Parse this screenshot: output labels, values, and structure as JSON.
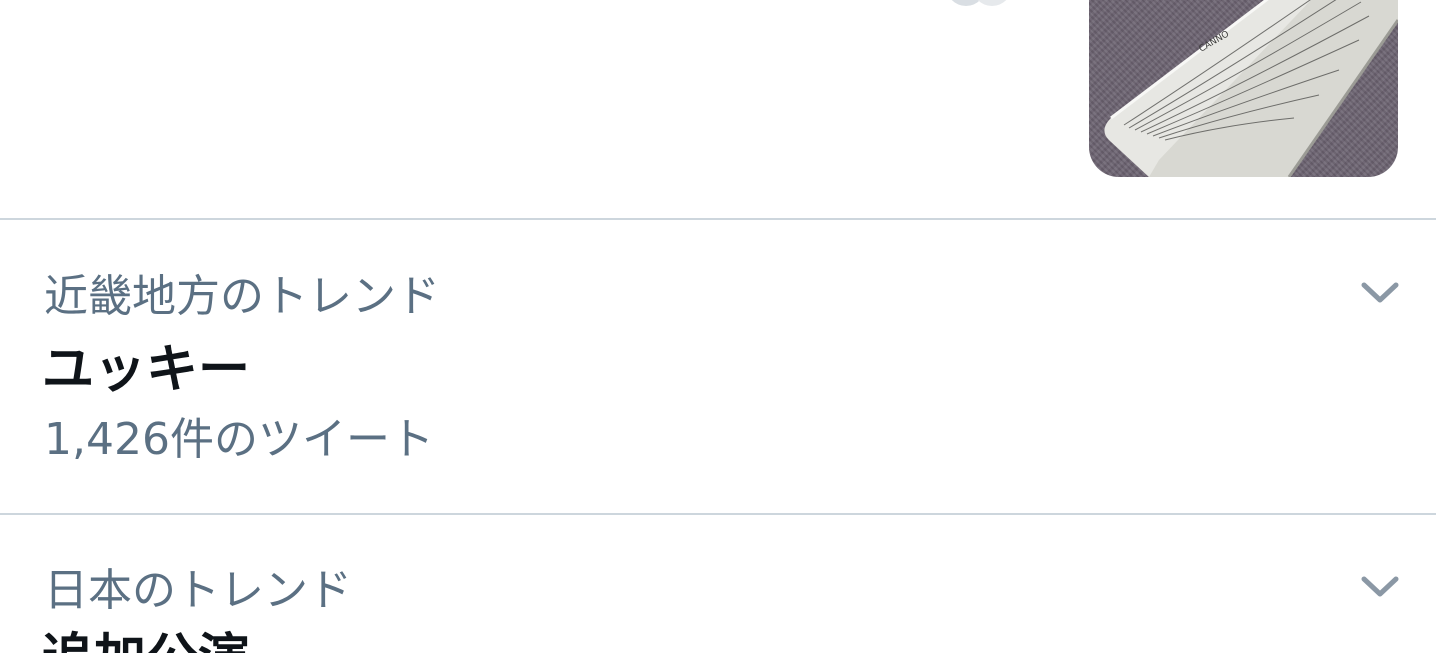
{
  "trends": [
    {
      "context": "近畿地方のトレンド",
      "title": "ユッキー",
      "count": "1,426件のツイート"
    },
    {
      "context": "日本のトレンド",
      "title": "追加公演"
    }
  ],
  "icons": {
    "more": "chevron-down-icon"
  },
  "colors": {
    "secondary_text": "#5b7083",
    "primary_text": "#0f1419",
    "divider": "#cdd6dd",
    "chevron": "#8b98a5"
  }
}
